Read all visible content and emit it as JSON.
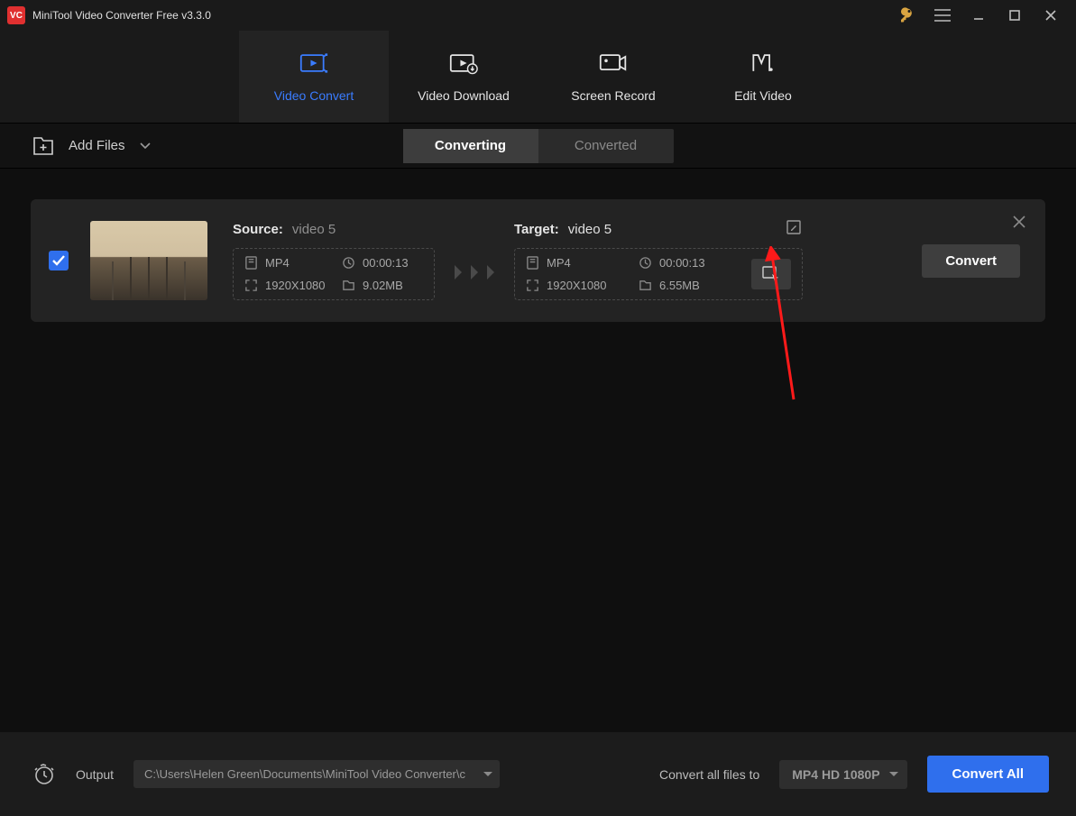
{
  "titlebar": {
    "title": "MiniTool Video Converter Free v3.3.0",
    "icon_text": "VC"
  },
  "maintabs": {
    "video_convert": "Video Convert",
    "video_download": "Video Download",
    "screen_record": "Screen Record",
    "edit_video": "Edit Video"
  },
  "subbar": {
    "add_files": "Add Files",
    "converting": "Converting",
    "converted": "Converted"
  },
  "item": {
    "source_label": "Source:",
    "source_name": "video 5",
    "source": {
      "format": "MP4",
      "duration": "00:00:13",
      "resolution": "1920X1080",
      "size": "9.02MB"
    },
    "target_label": "Target:",
    "target_name": "video 5",
    "target": {
      "format": "MP4",
      "duration": "00:00:13",
      "resolution": "1920X1080",
      "size": "6.55MB"
    },
    "convert": "Convert"
  },
  "footer": {
    "output_label": "Output",
    "output_path": "C:\\Users\\Helen Green\\Documents\\MiniTool Video Converter\\c",
    "convert_all_label": "Convert all files to",
    "format": "MP4 HD 1080P",
    "convert_all": "Convert All"
  }
}
